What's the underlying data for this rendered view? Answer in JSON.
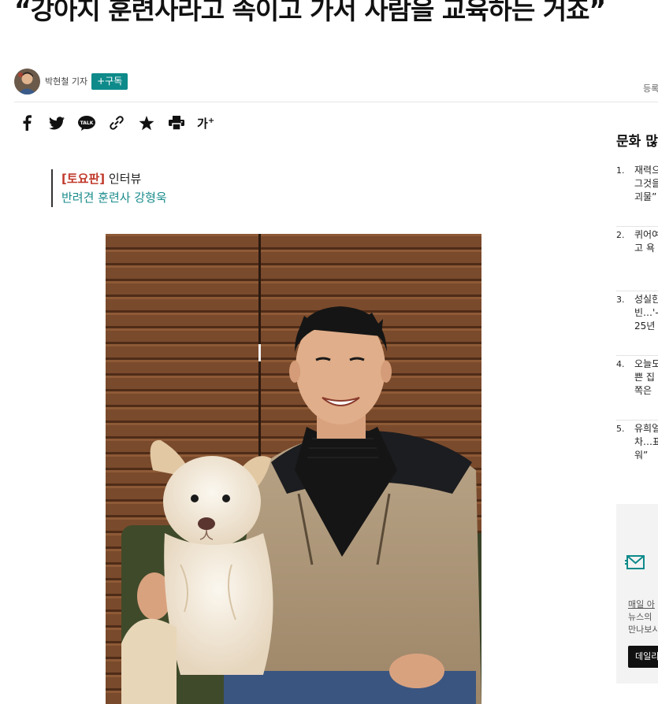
{
  "article": {
    "headline": "“강아지 훈련사라고 속이고 가서 사람을 교육하는 거죠”",
    "reporter": "박현철 기자",
    "subscribe_label": "+구독",
    "registered_label": "등록",
    "subhead": {
      "tag": "[토요판]",
      "kind": "인터뷰",
      "line2": "반려견 훈련사 강형욱"
    },
    "share_font_label": "가",
    "share_font_sup": "+"
  },
  "sidebar": {
    "title": "문화 많이",
    "ranks": [
      {
        "num": "1.",
        "text": "재력으 그것을 괴물”"
      },
      {
        "num": "2.",
        "text": "퀴어여 고 욕"
      },
      {
        "num": "3.",
        "text": "성실한 빈…'- 25년"
      },
      {
        "num": "4.",
        "text": "오늘도 쁜 집 쪽은"
      },
      {
        "num": "5.",
        "text": "유희얼 차…표 워”"
      }
    ],
    "newsletter": {
      "link": "매일 아",
      "desc1": "뉴스의",
      "desc2": "만나보시",
      "button": "데일리"
    }
  },
  "icons": [
    "facebook-icon",
    "twitter-icon",
    "kakaotalk-icon",
    "link-icon",
    "star-icon",
    "print-icon",
    "mail-icon"
  ],
  "colors": {
    "accent": "#0e8a8a",
    "tag_red": "#c0392b",
    "subhead_teal": "#1a8b8b"
  }
}
